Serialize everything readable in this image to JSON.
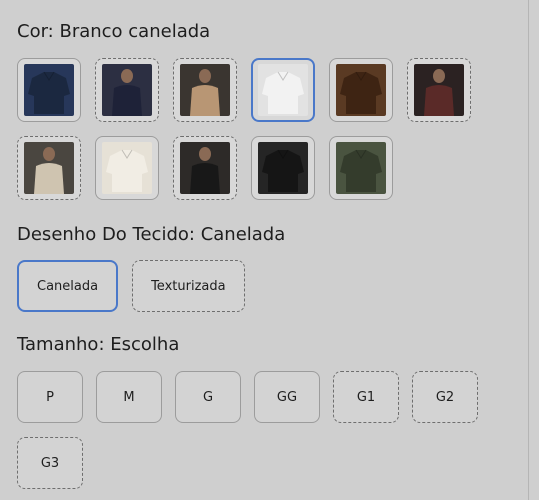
{
  "color": {
    "label": "Cor:",
    "value": "Branco canelada",
    "swatches": [
      {
        "name": "navy",
        "bg": "#27375a",
        "fg": "#1b2840",
        "kind": "flat",
        "dashed": false,
        "selected": false
      },
      {
        "name": "navy-model",
        "bg": "#2c2f42",
        "fg": "#1e2238",
        "kind": "model",
        "dashed": true,
        "selected": false
      },
      {
        "name": "beige-model",
        "bg": "#3a3530",
        "fg": "#b89674",
        "kind": "model",
        "dashed": true,
        "selected": false
      },
      {
        "name": "white",
        "bg": "#e2e2e2",
        "fg": "#f2f2f2",
        "kind": "flat",
        "dashed": false,
        "selected": true
      },
      {
        "name": "brown",
        "bg": "#5a3a23",
        "fg": "#3e2413",
        "kind": "flat",
        "dashed": false,
        "selected": false
      },
      {
        "name": "wine-model",
        "bg": "#2b2222",
        "fg": "#5a2a28",
        "kind": "model",
        "dashed": true,
        "selected": false
      },
      {
        "name": "sand-model",
        "bg": "#4a4640",
        "fg": "#cfc4b0",
        "kind": "model",
        "dashed": true,
        "selected": false
      },
      {
        "name": "offwhite",
        "bg": "#e6e1d6",
        "fg": "#f1ede4",
        "kind": "flat",
        "dashed": false,
        "selected": false
      },
      {
        "name": "black-model",
        "bg": "#2d2a28",
        "fg": "#181818",
        "kind": "model",
        "dashed": true,
        "selected": false
      },
      {
        "name": "black",
        "bg": "#252525",
        "fg": "#151515",
        "kind": "flat",
        "dashed": false,
        "selected": false
      },
      {
        "name": "olive",
        "bg": "#4a5440",
        "fg": "#343c2c",
        "kind": "flat",
        "dashed": false,
        "selected": false
      }
    ]
  },
  "fabric": {
    "label": "Desenho Do Tecido:",
    "value": "Canelada",
    "options": [
      {
        "label": "Canelada",
        "selected": true,
        "dashed": false
      },
      {
        "label": "Texturizada",
        "selected": false,
        "dashed": true
      }
    ]
  },
  "size": {
    "label": "Tamanho:",
    "value": "Escolha",
    "options": [
      {
        "label": "P",
        "dashed": false
      },
      {
        "label": "M",
        "dashed": false
      },
      {
        "label": "G",
        "dashed": false
      },
      {
        "label": "GG",
        "dashed": false
      },
      {
        "label": "G1",
        "dashed": true
      },
      {
        "label": "G2",
        "dashed": true
      },
      {
        "label": "G3",
        "dashed": true
      }
    ]
  }
}
